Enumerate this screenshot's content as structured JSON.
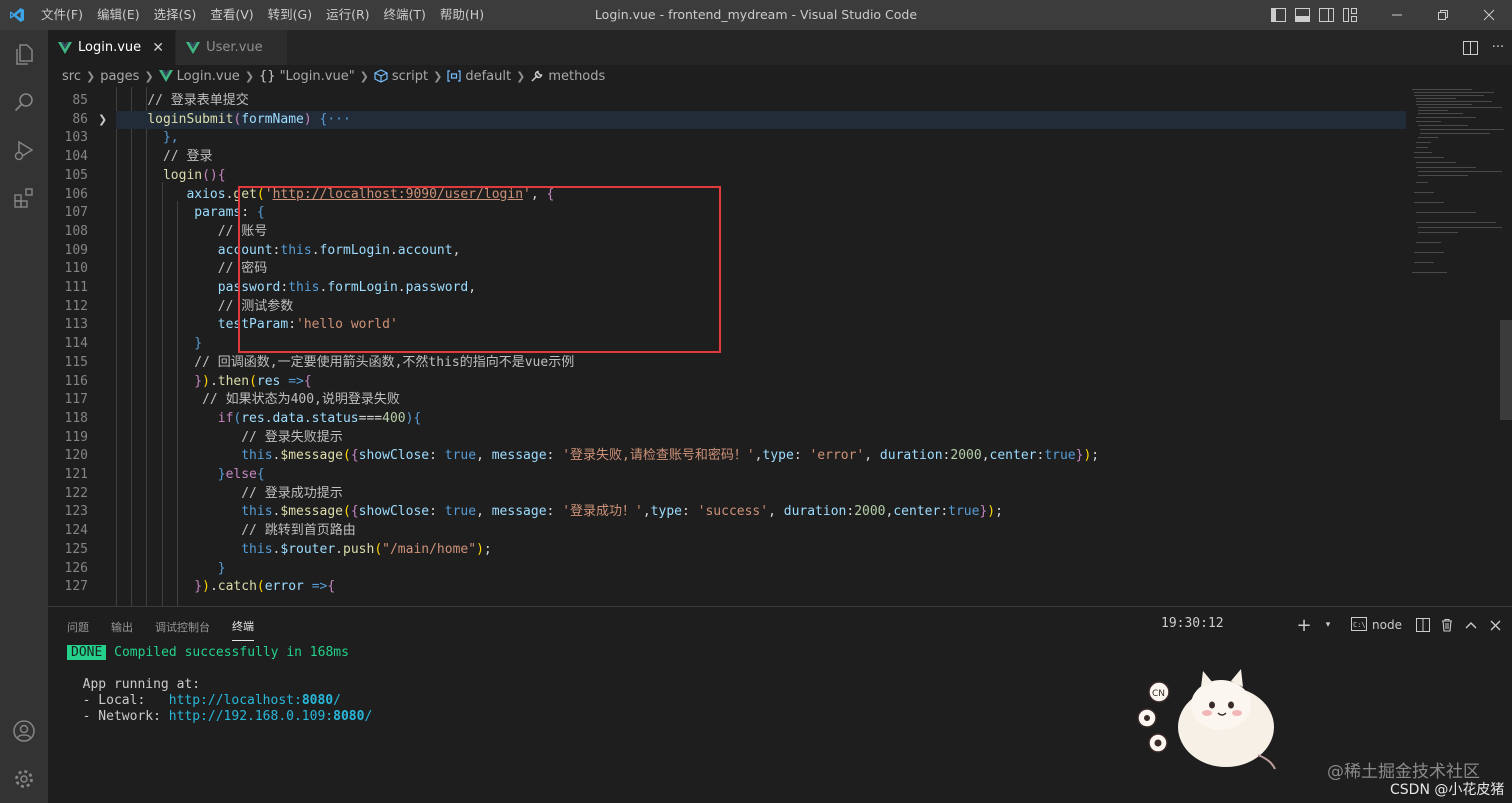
{
  "titlebar": {
    "menu": [
      "文件(F)",
      "编辑(E)",
      "选择(S)",
      "查看(V)",
      "转到(G)",
      "运行(R)",
      "终端(T)",
      "帮助(H)"
    ],
    "title": "Login.vue - frontend_mydream - Visual Studio Code"
  },
  "tabs": [
    {
      "label": "Login.vue",
      "active": true
    },
    {
      "label": "User.vue",
      "active": false
    }
  ],
  "breadcrumb": {
    "items": [
      "src",
      "pages",
      "Login.vue",
      "\"Login.vue\"",
      "script",
      "default",
      "methods"
    ],
    "braces": "{}"
  },
  "editor": {
    "line_numbers": [
      "85",
      "86",
      "103",
      "104",
      "105",
      "106",
      "107",
      "108",
      "109",
      "110",
      "111",
      "112",
      "113",
      "114",
      "115",
      "116",
      "117",
      "118",
      "119",
      "120",
      "121",
      "122",
      "123",
      "124",
      "125",
      "126",
      "127"
    ],
    "folded_marker": "{···",
    "code": {
      "l85": "// 登录表单提交",
      "l86_fn": "loginSubmit",
      "l86_param": "formName",
      "l103": "},",
      "l104": "// 登录",
      "l105_fn": "login",
      "l106_obj": "axios",
      "l106_fn": "get",
      "l106_url": "http://localhost:9090/user/login",
      "l107_key": "params",
      "l108": "// 账号",
      "l109_key": "account",
      "l109_this": "this",
      "l109_prop": "formLogin",
      "l109_field": "account",
      "l110": "// 密码",
      "l111_key": "password",
      "l111_this": "this",
      "l111_prop": "formLogin",
      "l111_field": "password",
      "l112": "// 测试参数",
      "l113_key": "testParam",
      "l113_val": "'hello world'",
      "l115": "// 回调函数,一定要使用箭头函数,不然this的指向不是vue示例",
      "l116_then": "then",
      "l116_res": "res",
      "l117": "// 如果状态为400,说明登录失败",
      "l118_if": "if",
      "l118_expr": "res.data.status",
      "l118_num": "400",
      "l119": "// 登录失败提示",
      "l120_this": "this",
      "l120_fn": "$message",
      "l120_k1": "showClose",
      "l120_true": "true",
      "l120_k2": "message",
      "l120_msg": "'登录失败,请检查账号和密码！'",
      "l120_k3": "type",
      "l120_type": "'error'",
      "l120_k4": "duration",
      "l120_dur": "2000",
      "l120_k5": "center",
      "l121_else": "else",
      "l122": "// 登录成功提示",
      "l123_this": "this",
      "l123_fn": "$message",
      "l123_k1": "showClose",
      "l123_true": "true",
      "l123_k2": "message",
      "l123_msg": "'登录成功！'",
      "l123_k3": "type",
      "l123_type": "'success'",
      "l123_k4": "duration",
      "l123_dur": "2000",
      "l123_k5": "center",
      "l124": "// 跳转到首页路由",
      "l125_this": "this",
      "l125_router": "$router",
      "l125_fn": "push",
      "l125_path": "\"/main/home\"",
      "l127_catch": "catch",
      "l127_err": "error"
    }
  },
  "panel": {
    "tabs": [
      "问题",
      "输出",
      "调试控制台",
      "终端"
    ],
    "active_tab": "终端",
    "terminal_name": "node",
    "done": "DONE",
    "compiled": "Compiled successfully in 168ms",
    "time": "19:30:12",
    "running": "App running at:",
    "local_label": "- Local:   ",
    "local_url_prefix": "http://localhost:",
    "local_port": "8080",
    "local_url_suffix": "/",
    "network_label": "- Network: ",
    "network_url_prefix": "http://192.168.0.109:",
    "network_port": "8080",
    "network_url_suffix": "/"
  },
  "watermarks": {
    "juejin": "@稀土掘金技术社区",
    "csdn": "CSDN @小花皮猪"
  },
  "colors": {
    "accent_box": "#e0393e",
    "done_green": "#23d18b"
  }
}
